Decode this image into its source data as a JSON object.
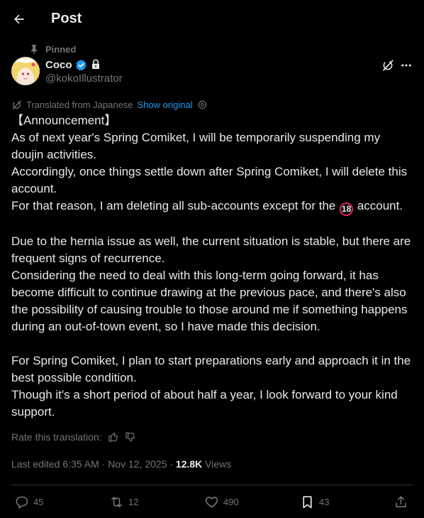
{
  "header": {
    "title": "Post"
  },
  "post": {
    "pinned_label": "Pinned",
    "author": {
      "display_name": "Coco",
      "handle": "@kokoIllustrator"
    },
    "translation": {
      "label": "Translated from Japanese",
      "show_original": "Show original"
    },
    "body": {
      "line1": "【Announcement】",
      "line2": "As of next year's Spring Comiket, I will be temporarily suspending my doujin activities.",
      "line3": "Accordingly, once things settle down after Spring Comiket, I will delete this account.",
      "line4_before": "For that reason, I am deleting all sub-accounts except for the ",
      "badge": "18",
      "line4_after": " account.",
      "para2_a": "Due to the hernia issue as well, the current situation is stable, but there are frequent signs of recurrence.",
      "para2_b": "Considering the need to deal with this long-term going forward, it has become difficult to continue drawing at the previous pace, and there's also the possibility of causing trouble to those around me if something happens during an out-of-town event, so I have made this decision.",
      "para3_a": "For Spring Comiket, I plan to start preparations early and approach it in the best possible condition.",
      "para3_b": "Though it's a short period of about half a year, I look forward to your kind support."
    },
    "rate_translation": "Rate this translation:",
    "meta": {
      "edited": "Last edited 6:35 AM · Nov 12, 2025 · ",
      "views_count": "12.8K",
      "views_label": " Views"
    },
    "actions": {
      "replies": "45",
      "reposts": "12",
      "likes": "490",
      "bookmarks": "43"
    }
  },
  "colors": {
    "background": "#000000",
    "text": "#e7e9ea",
    "muted": "#71767b",
    "link": "#1d9bf0",
    "verified": "#1d9bf0",
    "badge_ring": "#e0245e"
  }
}
